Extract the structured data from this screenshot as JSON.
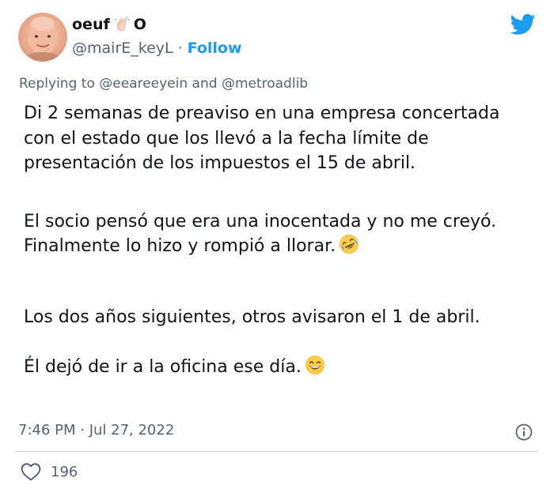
{
  "author": {
    "display_name": "oeuf",
    "name_suffix": "O",
    "name_emoji": "clapping-hands-emoji",
    "handle": "@mairE_keyL",
    "separator": "·",
    "follow_label": "Follow"
  },
  "reply": {
    "prefix": "Replying to",
    "mention_1": "@eeareeyein",
    "connector": "and",
    "mention_2": "@metroadlib"
  },
  "body": {
    "p1_line1": "Di 2 semanas de preaviso en una empresa concertada",
    "p1_line2": "con el estado que los llevó a la fecha límite de",
    "p1_line3": "presentación de los impuestos el 15 de abril.",
    "p2_line1": "El socio pensó que era una inocentada y no me creyó.",
    "p2_line2": "Finalmente lo hizo y rompió a llorar.",
    "p2_emoji": "rolling-on-floor-laughing-emoji",
    "p3_line1": "Los dos años siguientes, otros avisaron el 1 de abril.",
    "p4_line1": "Él dejó de ir a la oficina ese día.",
    "p4_emoji": "grinning-face-emoji"
  },
  "meta": {
    "timestamp": "7:46 PM · Jul 27, 2022"
  },
  "actions": {
    "like_count": "196"
  },
  "colors": {
    "brand_blue": "#1d9bf0",
    "text_primary": "#0f1419",
    "text_secondary": "#536471",
    "divider": "#cfd9de"
  },
  "icons": {
    "platform": "twitter-bird-icon",
    "info": "info-icon",
    "like": "heart-icon"
  }
}
